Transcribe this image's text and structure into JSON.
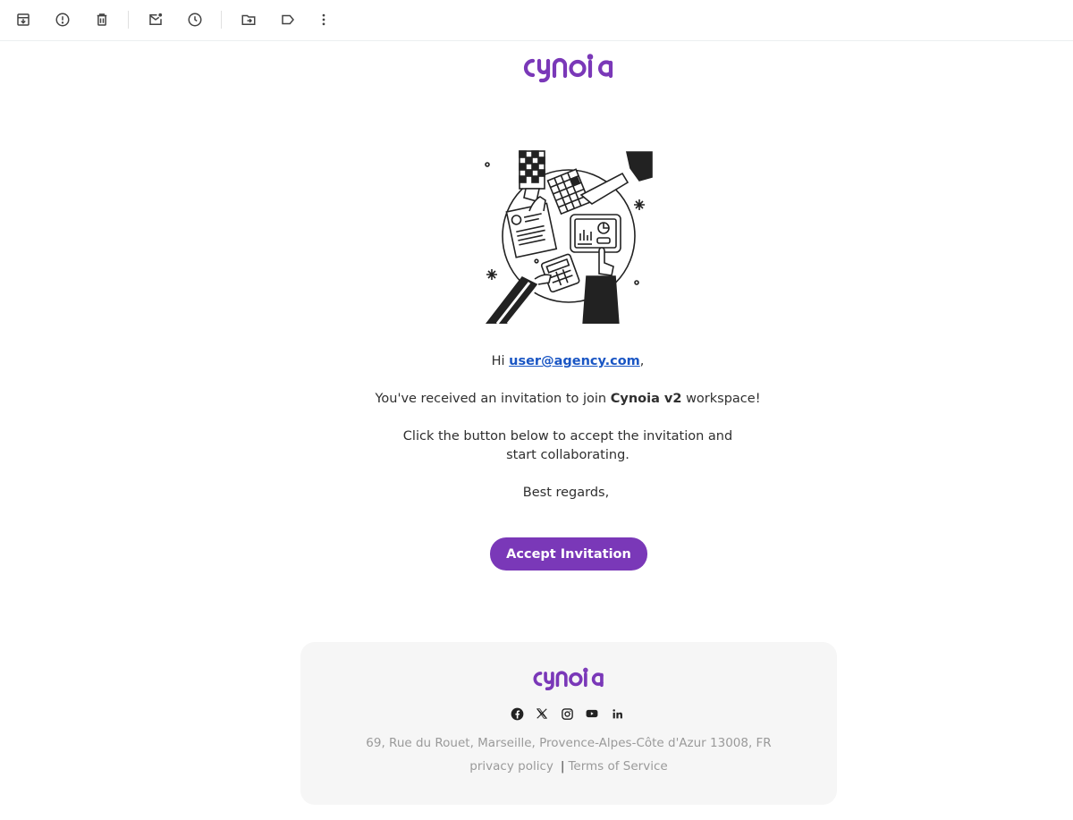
{
  "toolbar": {
    "icons": [
      "archive-icon",
      "report-spam-icon",
      "delete-icon",
      "mark-unread-icon",
      "snooze-icon",
      "move-to-icon",
      "label-icon",
      "more-options-icon"
    ]
  },
  "email": {
    "brand": "cynoia",
    "brand_color": "#7a38b8",
    "greeting_prefix": "Hi ",
    "recipient_email": "user@agency.com",
    "greeting_suffix": ",",
    "invite_prefix": "You've received an invitation to join ",
    "workspace_name": "Cynoia v2",
    "invite_suffix": " workspace!",
    "instructions": "Click the button below to accept the invitation and start collaborating.",
    "sign_off": "Best regards,",
    "accept_button": "Accept Invitation"
  },
  "footer": {
    "brand": "cynoia",
    "social_icons": [
      "facebook-icon",
      "x-icon",
      "instagram-icon",
      "youtube-icon",
      "linkedin-icon"
    ],
    "address": "69, Rue du Rouet, Marseille, Provence-Alpes-Côte d'Azur 13008, FR",
    "privacy_link": "privacy policy",
    "separator": "|",
    "terms_link": "Terms of Service"
  }
}
